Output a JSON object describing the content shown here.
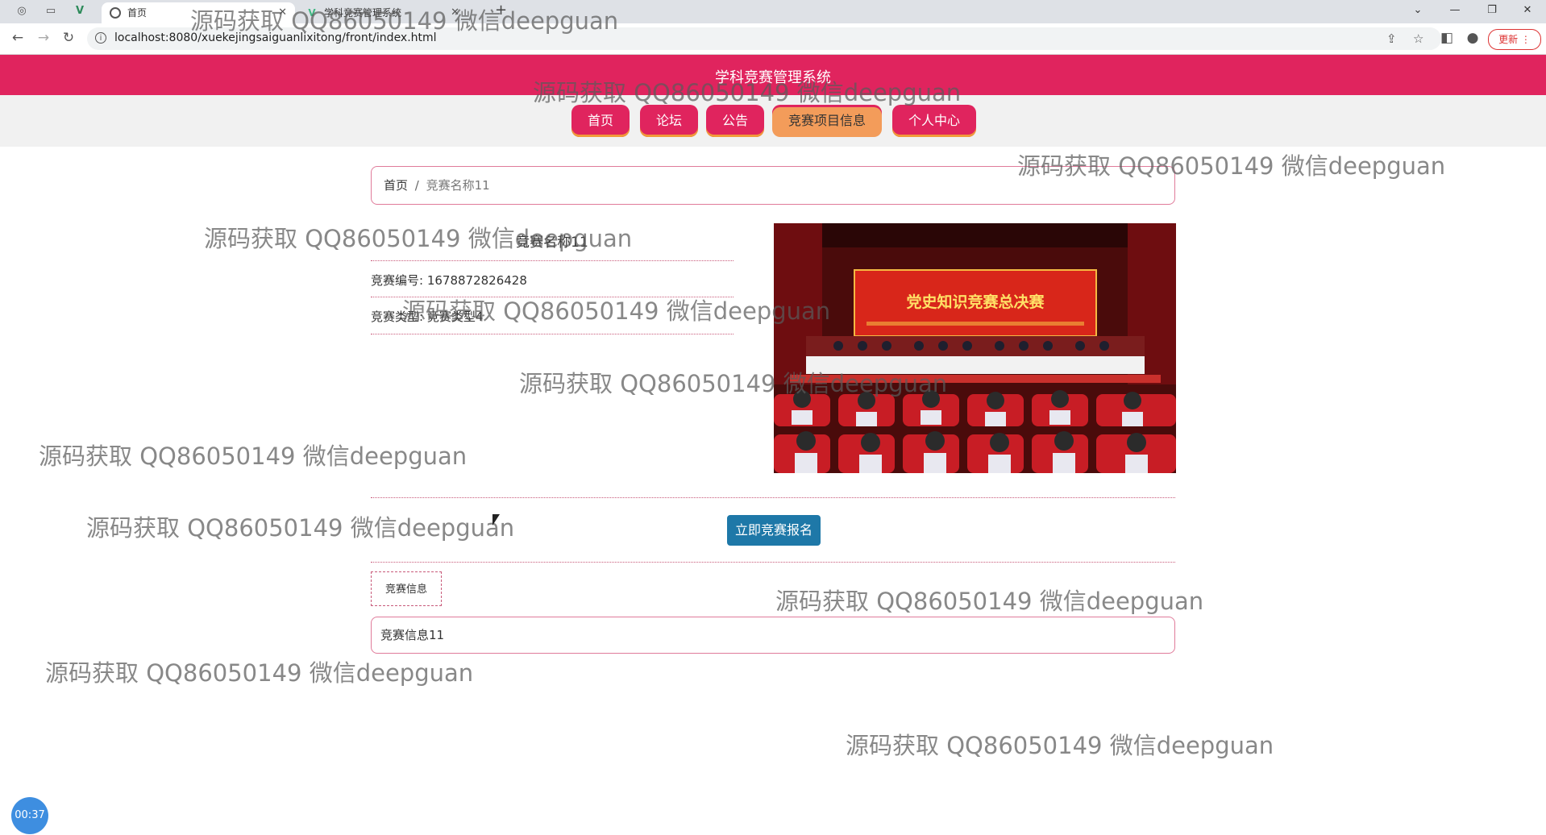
{
  "browser": {
    "tabs": [
      {
        "title": "首页",
        "active": true
      },
      {
        "title": "学科竞赛管理系统",
        "active": false
      }
    ],
    "new_tab": "+",
    "url": "localhost:8080/xuekejingsaiguanlixitong/front/index.html",
    "update_label": "更新"
  },
  "site": {
    "title": "学科竞赛管理系统",
    "nav": [
      {
        "label": "首页",
        "active": false
      },
      {
        "label": "论坛",
        "active": false
      },
      {
        "label": "公告",
        "active": false
      },
      {
        "label": "竞赛项目信息",
        "active": true
      },
      {
        "label": "个人中心",
        "active": false
      }
    ]
  },
  "breadcrumb": {
    "home": "首页",
    "separator": "/",
    "current": "竞赛名称11"
  },
  "detail": {
    "name": "竞赛名称11",
    "number": "竞赛编号: 1678872826428",
    "type": "竞赛类型: 竞赛类型4",
    "image_banner_text": "党史知识竞赛总决赛",
    "signup_label": "立即竞赛报名"
  },
  "info": {
    "tab_label": "竞赛信息",
    "content": "竞赛信息11"
  },
  "recording_timer": "00:37",
  "watermark": "源码获取 QQ86050149 微信deepguan",
  "colors": {
    "brand": "#e0245e",
    "accent": "#f39c5a",
    "signup": "#1e78a8"
  }
}
